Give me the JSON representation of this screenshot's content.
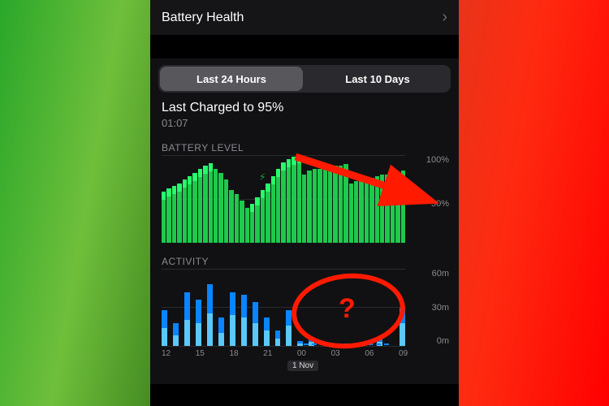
{
  "header": {
    "battery_health": "Battery Health"
  },
  "segmented": {
    "tab1": "Last 24 Hours",
    "tab2": "Last 10 Days"
  },
  "last_charged": {
    "line1": "Last Charged to 95%",
    "line2": "01:07"
  },
  "battery_level": {
    "label": "BATTERY LEVEL",
    "y_top": "100%",
    "y_mid": "50%"
  },
  "activity": {
    "label": "ACTIVITY",
    "y_top": "60m",
    "y_mid": "30m",
    "y_bot": "0m",
    "date_badge": "1 Nov",
    "ticks": [
      "12",
      "15",
      "18",
      "21",
      "00",
      "03",
      "06",
      "09"
    ]
  },
  "annotation": {
    "question": "?"
  },
  "chart_data": [
    {
      "type": "bar",
      "title": "BATTERY LEVEL",
      "ylabel": "%",
      "ylim": [
        0,
        100
      ],
      "series": [
        {
          "name": "level",
          "values": [
            58,
            62,
            65,
            68,
            72,
            76,
            80,
            84,
            88,
            91,
            84,
            80,
            72,
            60,
            56,
            48,
            40,
            44,
            52,
            60,
            68,
            76,
            84,
            92,
            95,
            98,
            100,
            78,
            82,
            84,
            84,
            86,
            86,
            88,
            88,
            90,
            68,
            70,
            72,
            74,
            74,
            76,
            78,
            78,
            80,
            80,
            82
          ]
        },
        {
          "name": "charging",
          "values": [
            1,
            1,
            1,
            1,
            1,
            1,
            1,
            1,
            1,
            1,
            0,
            0,
            0,
            0,
            0,
            0,
            0,
            1,
            1,
            1,
            1,
            1,
            1,
            1,
            1,
            1,
            1,
            0,
            0,
            0,
            0,
            0,
            0,
            0,
            0,
            0,
            0,
            0,
            0,
            0,
            0,
            0,
            0,
            0,
            0,
            0,
            0
          ]
        }
      ]
    },
    {
      "type": "bar",
      "title": "ACTIVITY",
      "ylabel": "minutes",
      "ylim": [
        0,
        60
      ],
      "x_ticks": [
        "12",
        "",
        "",
        "15",
        "",
        "",
        "18",
        "",
        "",
        "21",
        "",
        "",
        "00",
        "",
        "",
        "03",
        "",
        "",
        "06",
        "",
        "",
        "09"
      ],
      "series": [
        {
          "name": "total",
          "values": [
            28,
            18,
            42,
            36,
            48,
            22,
            42,
            40,
            34,
            22,
            12,
            28,
            4,
            5,
            0,
            0,
            0,
            0,
            0,
            5,
            0,
            30
          ]
        },
        {
          "name": "screen_on",
          "values": [
            14,
            8,
            20,
            18,
            25,
            10,
            24,
            22,
            18,
            12,
            6,
            16,
            2,
            3,
            0,
            0,
            0,
            0,
            0,
            3,
            0,
            18
          ]
        }
      ]
    }
  ]
}
